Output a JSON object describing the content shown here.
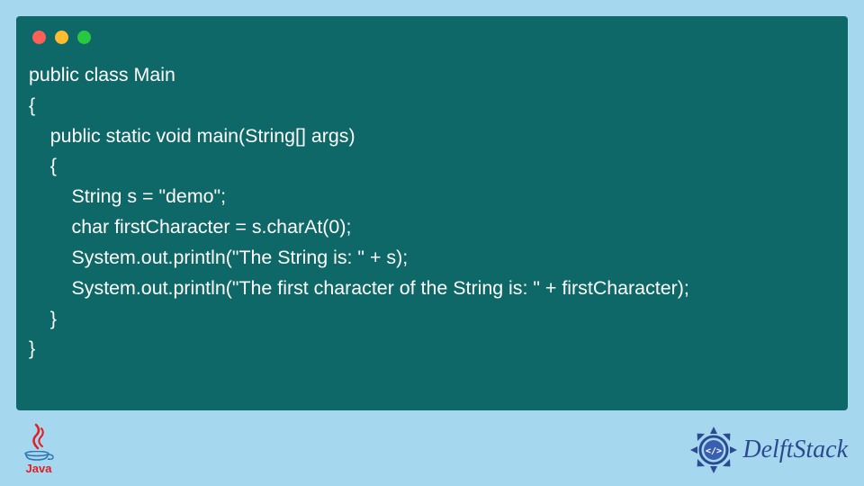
{
  "code": {
    "line1": "public class Main",
    "line2": "{",
    "line3": "    public static void main(String[] args)",
    "line4": "    {",
    "line5": "        String s = \"demo\";",
    "line6": "        char firstCharacter = s.charAt(0);",
    "line7": "        System.out.println(\"The String is: \" + s);",
    "line8": "        System.out.println(\"The first character of the String is: \" + firstCharacter);",
    "line9": "    }",
    "line10": "}"
  },
  "logos": {
    "java_label": "Java",
    "delft_label": "DelftStack"
  }
}
